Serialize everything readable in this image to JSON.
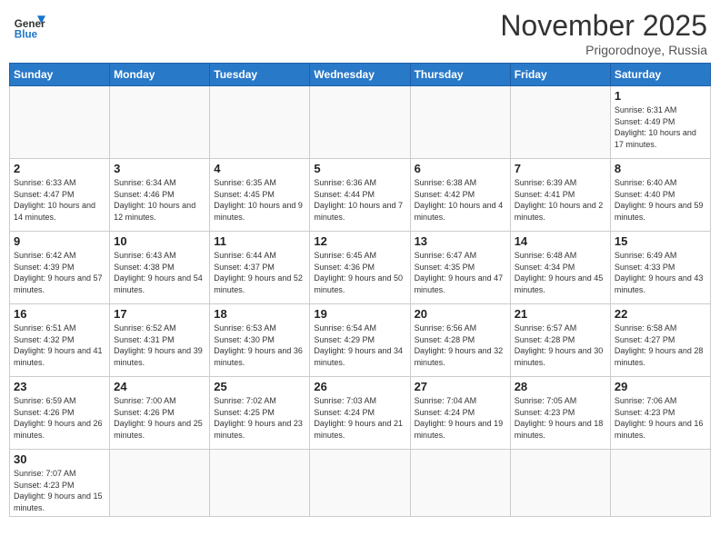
{
  "header": {
    "logo_general": "General",
    "logo_blue": "Blue",
    "month_title": "November 2025",
    "location": "Prigorodnoye, Russia"
  },
  "weekdays": [
    "Sunday",
    "Monday",
    "Tuesday",
    "Wednesday",
    "Thursday",
    "Friday",
    "Saturday"
  ],
  "weeks": [
    [
      {
        "day": "",
        "info": ""
      },
      {
        "day": "",
        "info": ""
      },
      {
        "day": "",
        "info": ""
      },
      {
        "day": "",
        "info": ""
      },
      {
        "day": "",
        "info": ""
      },
      {
        "day": "",
        "info": ""
      },
      {
        "day": "1",
        "info": "Sunrise: 6:31 AM\nSunset: 4:49 PM\nDaylight: 10 hours and 17 minutes."
      }
    ],
    [
      {
        "day": "2",
        "info": "Sunrise: 6:33 AM\nSunset: 4:47 PM\nDaylight: 10 hours and 14 minutes."
      },
      {
        "day": "3",
        "info": "Sunrise: 6:34 AM\nSunset: 4:46 PM\nDaylight: 10 hours and 12 minutes."
      },
      {
        "day": "4",
        "info": "Sunrise: 6:35 AM\nSunset: 4:45 PM\nDaylight: 10 hours and 9 minutes."
      },
      {
        "day": "5",
        "info": "Sunrise: 6:36 AM\nSunset: 4:44 PM\nDaylight: 10 hours and 7 minutes."
      },
      {
        "day": "6",
        "info": "Sunrise: 6:38 AM\nSunset: 4:42 PM\nDaylight: 10 hours and 4 minutes."
      },
      {
        "day": "7",
        "info": "Sunrise: 6:39 AM\nSunset: 4:41 PM\nDaylight: 10 hours and 2 minutes."
      },
      {
        "day": "8",
        "info": "Sunrise: 6:40 AM\nSunset: 4:40 PM\nDaylight: 9 hours and 59 minutes."
      }
    ],
    [
      {
        "day": "9",
        "info": "Sunrise: 6:42 AM\nSunset: 4:39 PM\nDaylight: 9 hours and 57 minutes."
      },
      {
        "day": "10",
        "info": "Sunrise: 6:43 AM\nSunset: 4:38 PM\nDaylight: 9 hours and 54 minutes."
      },
      {
        "day": "11",
        "info": "Sunrise: 6:44 AM\nSunset: 4:37 PM\nDaylight: 9 hours and 52 minutes."
      },
      {
        "day": "12",
        "info": "Sunrise: 6:45 AM\nSunset: 4:36 PM\nDaylight: 9 hours and 50 minutes."
      },
      {
        "day": "13",
        "info": "Sunrise: 6:47 AM\nSunset: 4:35 PM\nDaylight: 9 hours and 47 minutes."
      },
      {
        "day": "14",
        "info": "Sunrise: 6:48 AM\nSunset: 4:34 PM\nDaylight: 9 hours and 45 minutes."
      },
      {
        "day": "15",
        "info": "Sunrise: 6:49 AM\nSunset: 4:33 PM\nDaylight: 9 hours and 43 minutes."
      }
    ],
    [
      {
        "day": "16",
        "info": "Sunrise: 6:51 AM\nSunset: 4:32 PM\nDaylight: 9 hours and 41 minutes."
      },
      {
        "day": "17",
        "info": "Sunrise: 6:52 AM\nSunset: 4:31 PM\nDaylight: 9 hours and 39 minutes."
      },
      {
        "day": "18",
        "info": "Sunrise: 6:53 AM\nSunset: 4:30 PM\nDaylight: 9 hours and 36 minutes."
      },
      {
        "day": "19",
        "info": "Sunrise: 6:54 AM\nSunset: 4:29 PM\nDaylight: 9 hours and 34 minutes."
      },
      {
        "day": "20",
        "info": "Sunrise: 6:56 AM\nSunset: 4:28 PM\nDaylight: 9 hours and 32 minutes."
      },
      {
        "day": "21",
        "info": "Sunrise: 6:57 AM\nSunset: 4:28 PM\nDaylight: 9 hours and 30 minutes."
      },
      {
        "day": "22",
        "info": "Sunrise: 6:58 AM\nSunset: 4:27 PM\nDaylight: 9 hours and 28 minutes."
      }
    ],
    [
      {
        "day": "23",
        "info": "Sunrise: 6:59 AM\nSunset: 4:26 PM\nDaylight: 9 hours and 26 minutes."
      },
      {
        "day": "24",
        "info": "Sunrise: 7:00 AM\nSunset: 4:26 PM\nDaylight: 9 hours and 25 minutes."
      },
      {
        "day": "25",
        "info": "Sunrise: 7:02 AM\nSunset: 4:25 PM\nDaylight: 9 hours and 23 minutes."
      },
      {
        "day": "26",
        "info": "Sunrise: 7:03 AM\nSunset: 4:24 PM\nDaylight: 9 hours and 21 minutes."
      },
      {
        "day": "27",
        "info": "Sunrise: 7:04 AM\nSunset: 4:24 PM\nDaylight: 9 hours and 19 minutes."
      },
      {
        "day": "28",
        "info": "Sunrise: 7:05 AM\nSunset: 4:23 PM\nDaylight: 9 hours and 18 minutes."
      },
      {
        "day": "29",
        "info": "Sunrise: 7:06 AM\nSunset: 4:23 PM\nDaylight: 9 hours and 16 minutes."
      }
    ],
    [
      {
        "day": "30",
        "info": "Sunrise: 7:07 AM\nSunset: 4:23 PM\nDaylight: 9 hours and 15 minutes."
      },
      {
        "day": "",
        "info": ""
      },
      {
        "day": "",
        "info": ""
      },
      {
        "day": "",
        "info": ""
      },
      {
        "day": "",
        "info": ""
      },
      {
        "day": "",
        "info": ""
      },
      {
        "day": "",
        "info": ""
      }
    ]
  ]
}
